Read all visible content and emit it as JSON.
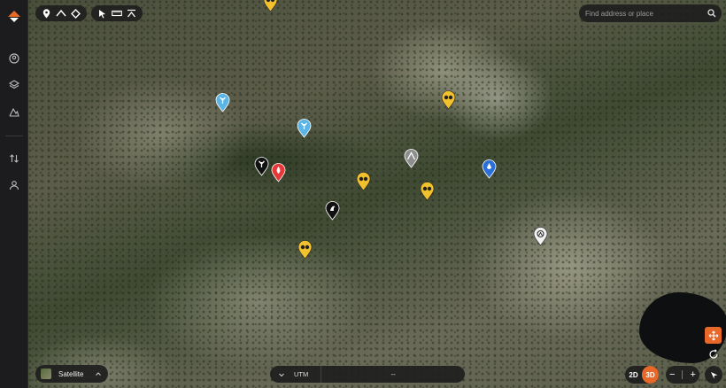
{
  "search": {
    "placeholder": "Find address or place"
  },
  "layer": {
    "label": "Satellite"
  },
  "coords": {
    "format": "UTM",
    "value": "--"
  },
  "view_toggle": {
    "two_d": "2D",
    "three_d": "3D",
    "active": "3D"
  },
  "zoom": {
    "out": "−",
    "in": "+"
  },
  "colors": {
    "accent": "#e8682a",
    "pin_yellow": "#f2c12e",
    "pin_blue_light": "#5ab4e5",
    "pin_blue": "#2d6fd8",
    "pin_red": "#e53838",
    "pin_black": "#111111",
    "pin_gray": "#8e8e8e",
    "pin_white": "#f2f2f2"
  },
  "sidebar": {
    "items": [
      "profile-icon",
      "layers-icon",
      "terrain-icon",
      "sort-icon",
      "account-icon"
    ]
  },
  "waypoints": [
    {
      "type": "binoculars",
      "color": "yellow"
    },
    {
      "type": "binoculars",
      "color": "yellow"
    },
    {
      "type": "binoculars",
      "color": "yellow"
    },
    {
      "type": "binoculars",
      "color": "yellow"
    },
    {
      "type": "binoculars",
      "color": "yellow"
    },
    {
      "type": "elk",
      "color": "light-blue"
    },
    {
      "type": "elk",
      "color": "light-blue"
    },
    {
      "type": "elk",
      "color": "black"
    },
    {
      "type": "flame",
      "color": "red"
    },
    {
      "type": "bird",
      "color": "black"
    },
    {
      "type": "tent",
      "color": "gray"
    },
    {
      "type": "drop",
      "color": "blue"
    },
    {
      "type": "camp",
      "color": "white"
    }
  ]
}
